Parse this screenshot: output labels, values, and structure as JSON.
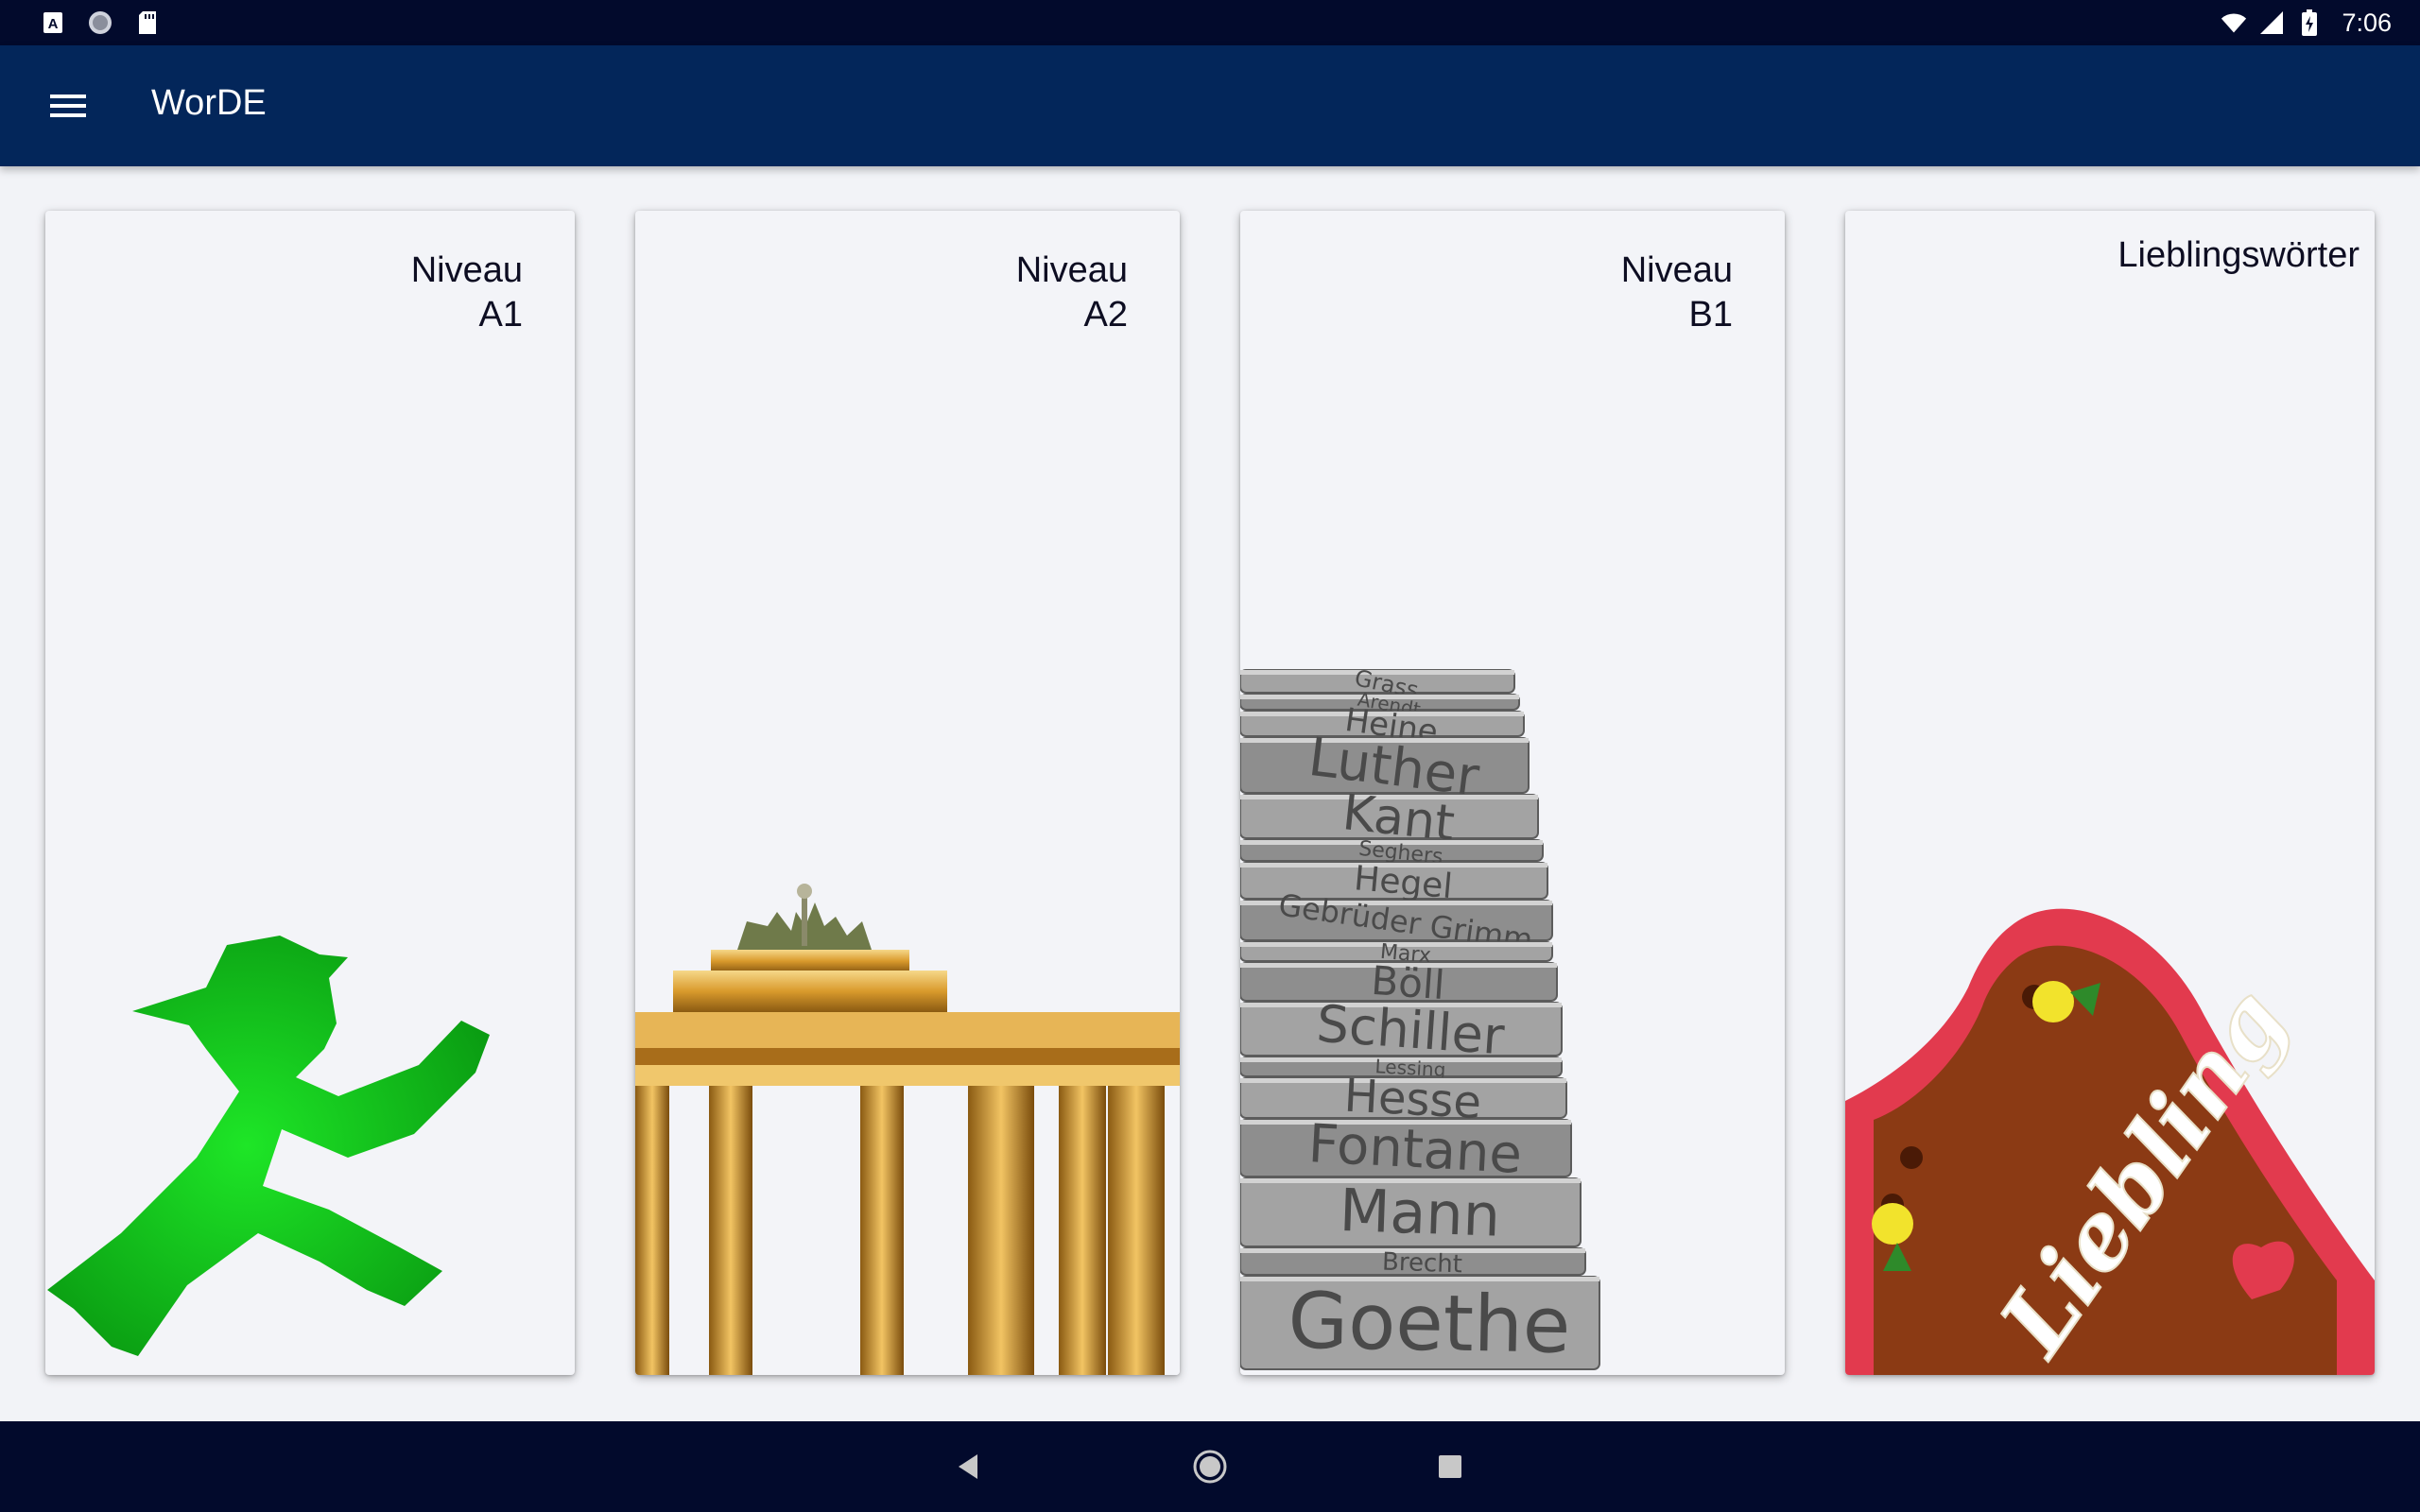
{
  "status_bar": {
    "time": "7:06",
    "left_icons": [
      "a-notification-icon",
      "circle-notification-icon",
      "sd-card-icon"
    ],
    "right_icons": [
      "wifi-icon",
      "signal-icon",
      "battery-charging-icon"
    ]
  },
  "app_bar": {
    "title": "WorDE",
    "menu_icon": "hamburger-menu-icon"
  },
  "cards": [
    {
      "line1": "Niveau",
      "line2": "A1",
      "image": "green-ampelmann-walking-figure"
    },
    {
      "line1": "Niveau",
      "line2": "A2",
      "image": "brandenburg-gate-illuminated"
    },
    {
      "line1": "Niveau",
      "line2": "B1",
      "image": "stack-of-author-books",
      "book_spines": [
        "Grass",
        "Arendt",
        "Heine",
        "Luther",
        "Kant",
        "Seghers",
        "Hegel",
        "Gebrüder Grimm",
        "Marx",
        "Böll",
        "Schiller",
        "Lessing",
        "Hesse",
        "Fontane",
        "Mann",
        "Brecht",
        "Goethe"
      ]
    },
    {
      "line1": "Lieblingswörter",
      "line2": "",
      "image": "gingerbread-heart",
      "heart_text": "Liebling"
    }
  ],
  "nav_bar": {
    "icons": [
      "back-triangle-icon",
      "home-circle-icon",
      "recents-square-icon"
    ]
  },
  "colors": {
    "status_bar": "#020a2c",
    "app_bar": "#03265a",
    "background": "#f2f3f7",
    "card": "#f3f4f8",
    "ampelmann_green": "#13c21a"
  }
}
